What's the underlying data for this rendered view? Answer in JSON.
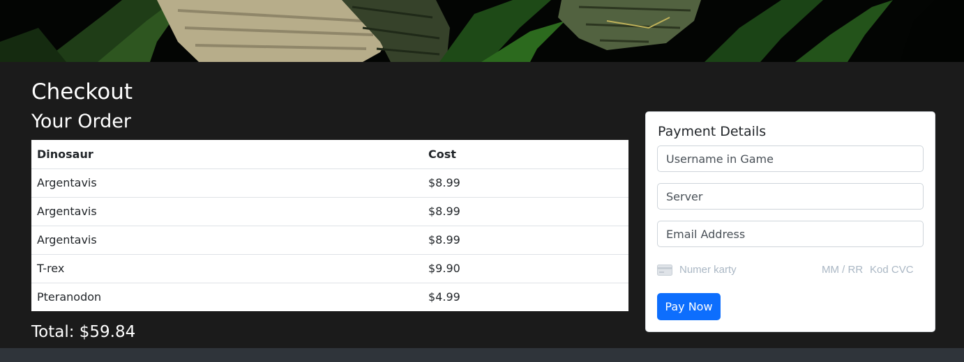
{
  "hero": {
    "image": "dinosaur-jungle-banner"
  },
  "checkout": {
    "title": "Checkout",
    "order_title": "Your Order",
    "columns": [
      "Dinosaur",
      "Cost"
    ],
    "items": [
      {
        "name": "Argentavis",
        "cost": "$8.99"
      },
      {
        "name": "Argentavis",
        "cost": "$8.99"
      },
      {
        "name": "Argentavis",
        "cost": "$8.99"
      },
      {
        "name": "T-rex",
        "cost": "$9.90"
      },
      {
        "name": "Pteranodon",
        "cost": "$4.99"
      }
    ],
    "total": "Total: $59.84"
  },
  "payment": {
    "title": "Payment Details",
    "username_placeholder": "Username in Game",
    "server_placeholder": "Server",
    "email_placeholder": "Email Address",
    "card_icon": "credit-card-icon",
    "card_number_placeholder": "Numer karty",
    "expiry_placeholder": "MM / RR",
    "cvc_placeholder": "Kod CVC",
    "pay_label": "Pay Now"
  },
  "colors": {
    "page_background": "#1b1b1b",
    "accent": "#0d6efd",
    "footer": "#2f343a",
    "placeholder_muted": "#aab7c4"
  }
}
